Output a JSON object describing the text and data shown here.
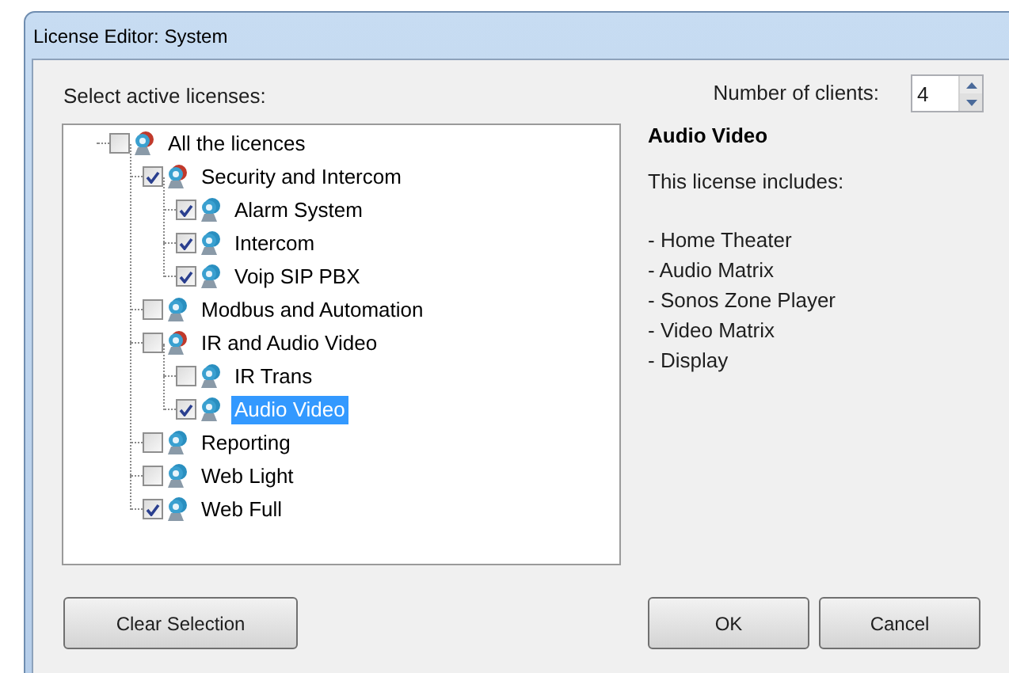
{
  "window": {
    "title": "License Editor: System"
  },
  "tree_label": "Select active licenses:",
  "tree": [
    {
      "label": "All the licences",
      "checked": false,
      "selected": false,
      "children": [
        {
          "label": "Security and Intercom",
          "checked": true,
          "selected": false,
          "children": [
            {
              "label": "Alarm System",
              "checked": true,
              "selected": false
            },
            {
              "label": "Intercom",
              "checked": true,
              "selected": false
            },
            {
              "label": "Voip SIP PBX",
              "checked": true,
              "selected": false
            }
          ]
        },
        {
          "label": "Modbus and Automation",
          "checked": false,
          "selected": false
        },
        {
          "label": "IR and Audio Video",
          "checked": false,
          "selected": false,
          "children": [
            {
              "label": "IR Trans",
              "checked": false,
              "selected": false
            },
            {
              "label": "Audio Video",
              "checked": true,
              "selected": true
            }
          ]
        },
        {
          "label": "Reporting",
          "checked": false,
          "selected": false
        },
        {
          "label": "Web Light",
          "checked": false,
          "selected": false
        },
        {
          "label": "Web Full",
          "checked": true,
          "selected": false
        }
      ]
    }
  ],
  "clients": {
    "label": "Number of clients:",
    "value": "4"
  },
  "details": {
    "title": "Audio Video",
    "intro": "This license includes:",
    "items": [
      "- Home Theater",
      "- Audio Matrix",
      "- Sonos Zone Player",
      "- Video Matrix",
      "- Display"
    ]
  },
  "buttons": {
    "clear": "Clear Selection",
    "ok": "OK",
    "cancel": "Cancel"
  }
}
